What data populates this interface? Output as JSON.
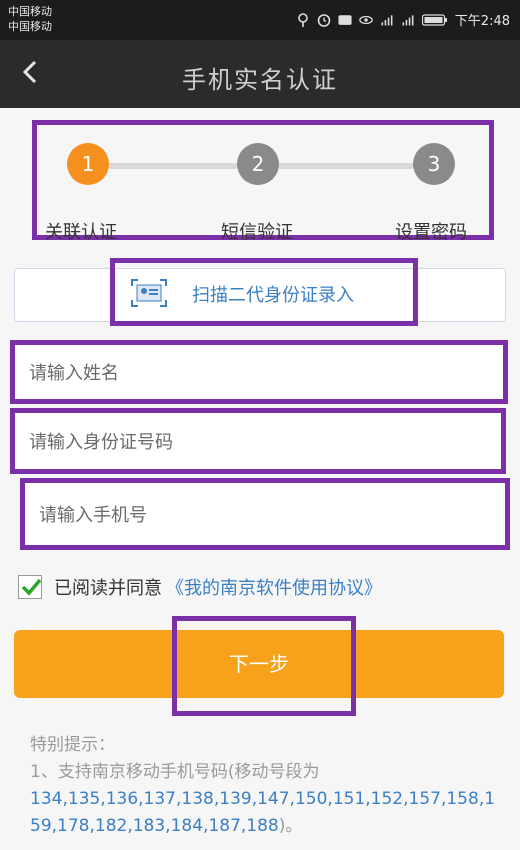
{
  "status_bar": {
    "carrier1": "中国移动",
    "carrier2": "中国移动",
    "time": "下午2:48"
  },
  "nav": {
    "back": "‹",
    "title": "手机实名认证"
  },
  "steps": [
    {
      "number": "1",
      "label": "关联认证"
    },
    {
      "number": "2",
      "label": "短信验证"
    },
    {
      "number": "3",
      "label": "设置密码"
    }
  ],
  "scan": {
    "label": "扫描二代身份证录入"
  },
  "form": {
    "name_placeholder": "请输入姓名",
    "id_placeholder": "请输入身份证号码",
    "phone_placeholder": "请输入手机号"
  },
  "agreement": {
    "text": "已阅读并同意",
    "link": "《我的南京软件使用协议》"
  },
  "next_button": "下一步",
  "tips": {
    "heading": "特别提示：",
    "line1": "1、支持南京移动手机号码(移动号段为",
    "numbers": "134,135,136,137,138,139,147,150,151,152,157,158,159,178,182,183,184,187,188",
    "closing": ")。"
  },
  "colors": {
    "accent_orange": "#f7a21a",
    "link_blue": "#3b7fc4",
    "frame_purple": "#7b2fa8"
  }
}
